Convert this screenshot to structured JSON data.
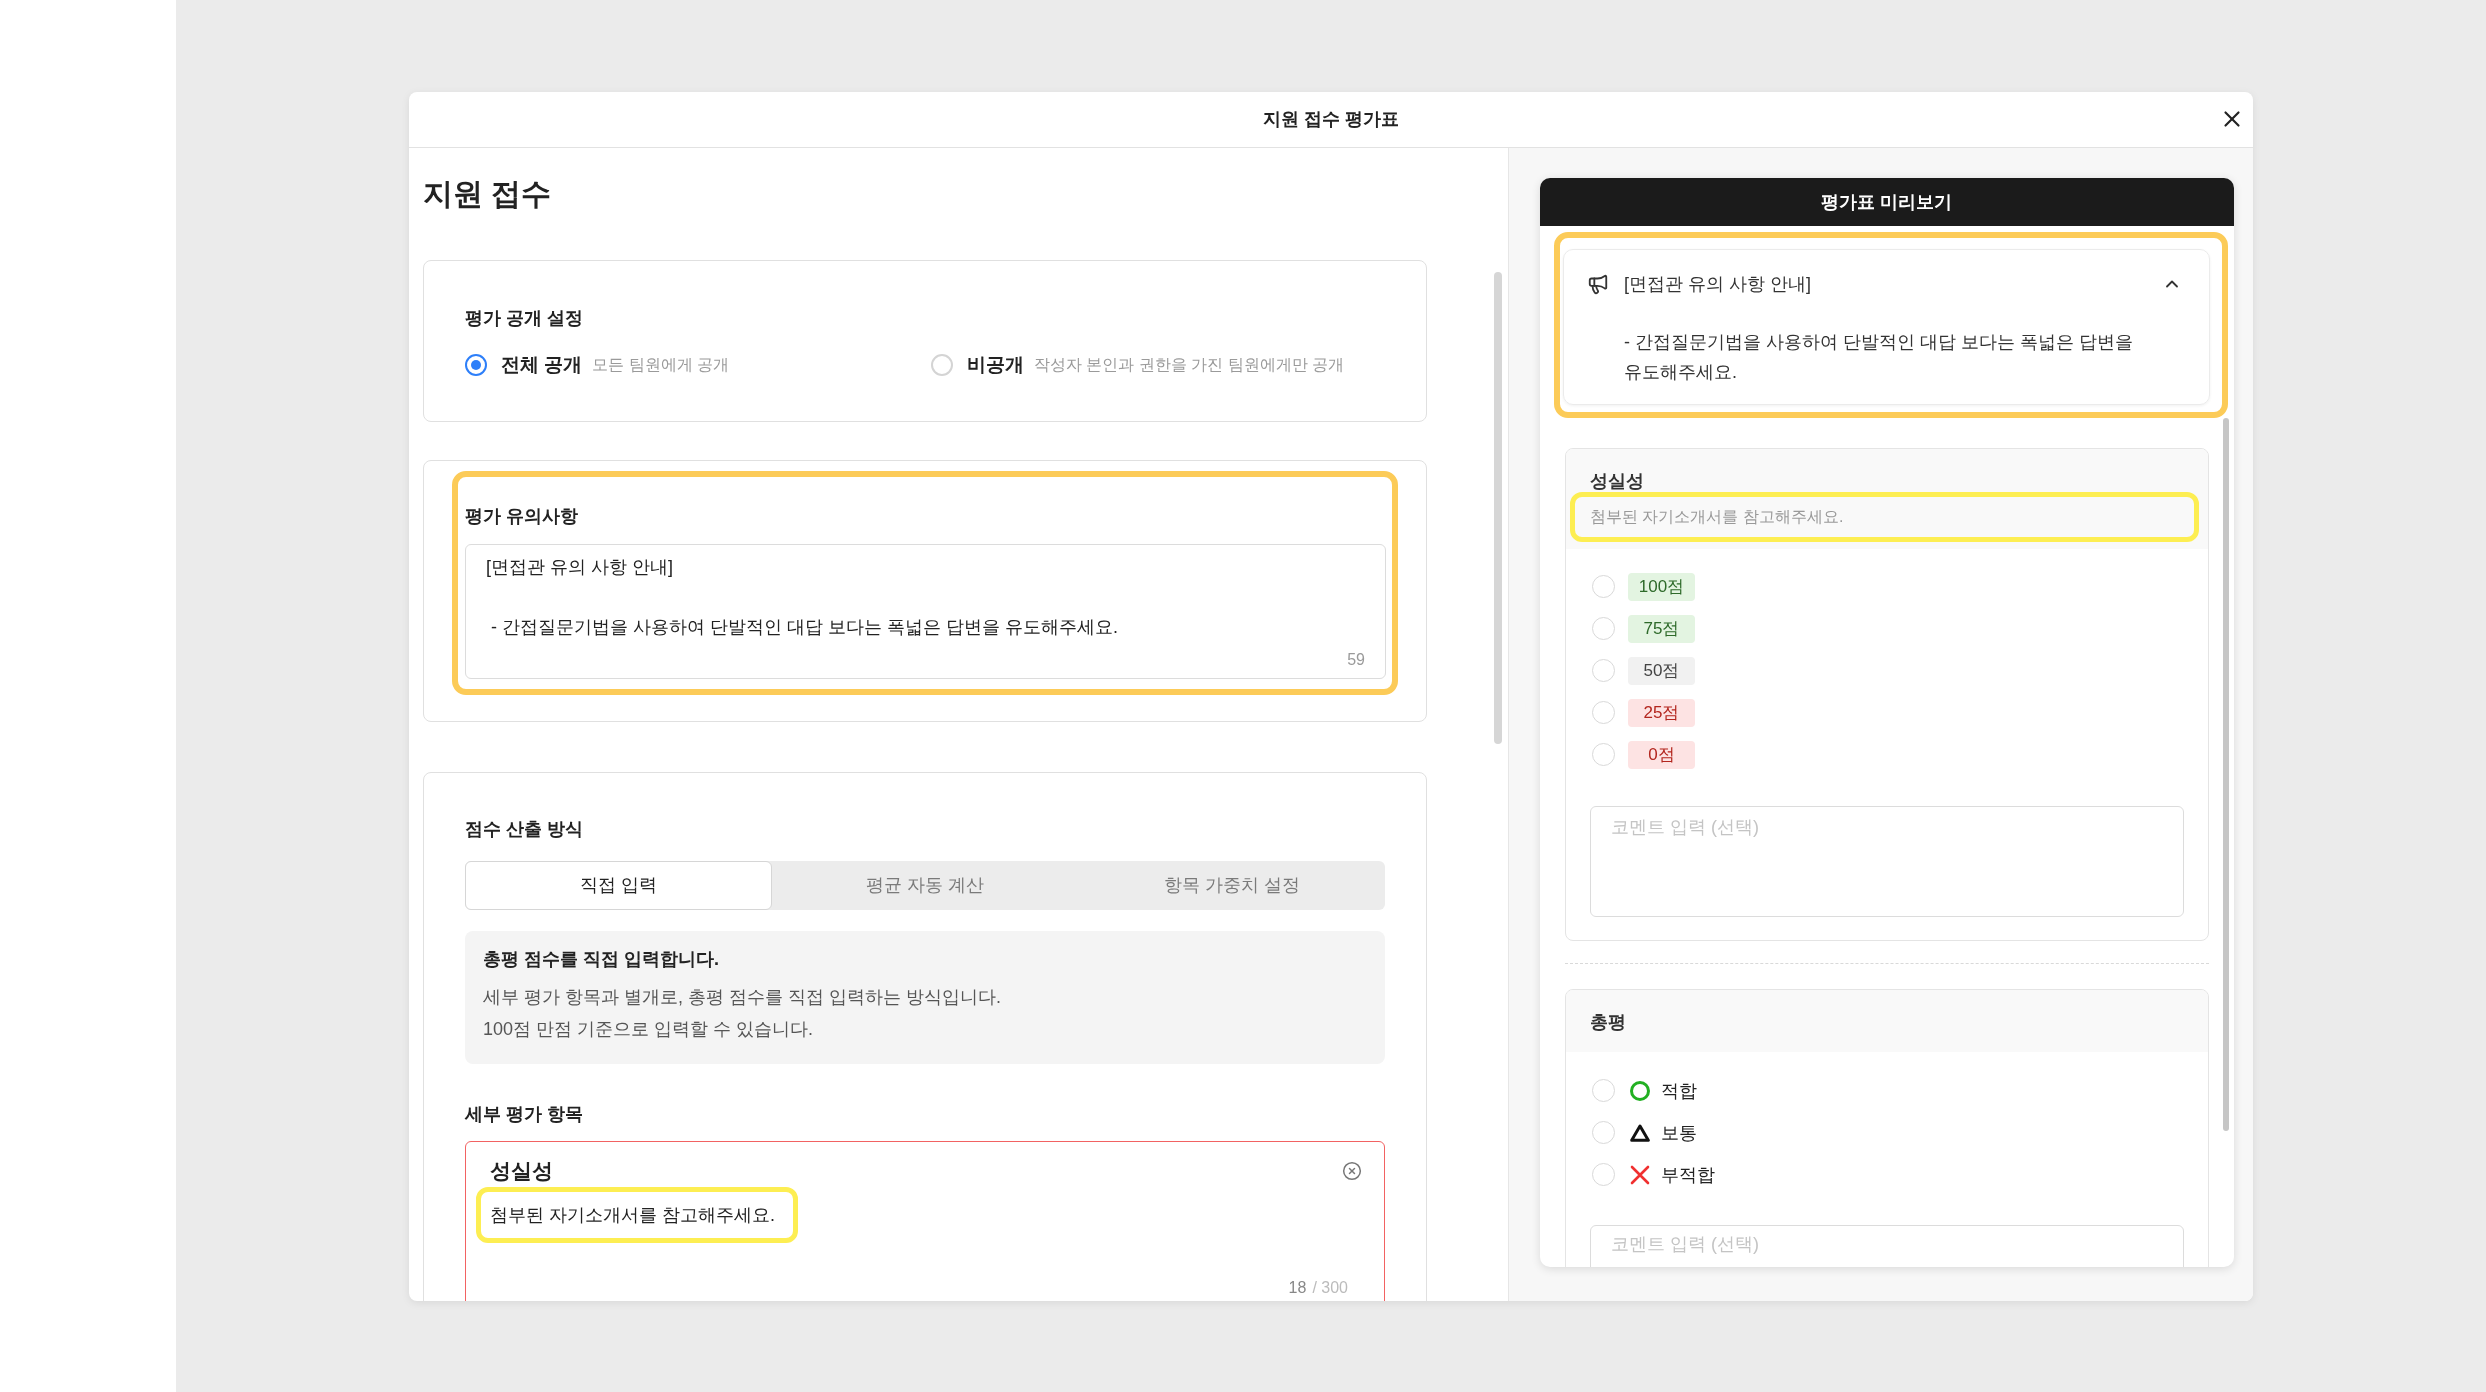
{
  "dialog": {
    "title": "지원 접수 평가표"
  },
  "form": {
    "title": "지원 접수",
    "visibility": {
      "label": "평가 공개 설정",
      "options": [
        {
          "label": "전체 공개",
          "description": "모든 팀원에게 공개",
          "selected": true
        },
        {
          "label": "비공개",
          "description": "작성자 본인과 권한을 가진 팀원에게만 공개",
          "selected": false
        }
      ]
    },
    "notes": {
      "label": "평가 유의사항",
      "highlighted": true,
      "value": "[면접관 유의 사항 안내]\n\n - 간접질문기법을 사용하여 단발적인 대답 보다는 폭넓은 답변을 유도해주세요.",
      "count": "59"
    },
    "scoring": {
      "label": "점수 산출 방식",
      "tabs": [
        {
          "label": "직접 입력",
          "selected": true
        },
        {
          "label": "평균 자동 계산",
          "selected": false
        },
        {
          "label": "항목 가중치 설정",
          "selected": false
        }
      ],
      "info": {
        "title": "총평 점수를 직접 입력합니다.",
        "lines": [
          "세부 평가 항목과 별개로, 총평 점수를 직접 입력하는 방식입니다.",
          "100점 만점 기준으로 입력할 수 있습니다."
        ]
      }
    },
    "details": {
      "label": "세부 평가 항목",
      "items": [
        {
          "title": "성실성",
          "description": "첨부된 자기소개서를 참고해주세요.",
          "highlighted": true,
          "invalid": true,
          "count": "18",
          "limit": "/ 300"
        }
      ]
    }
  },
  "preview": {
    "title": "평가표 미리보기",
    "notice": {
      "title": "[면접관 유의 사항 안내]",
      "body": "- 간접질문기법을 사용하여 단발적인 대답 보다는 폭넓은 답변을 유도해주세요.",
      "expanded": true,
      "highlighted": true
    },
    "criteria": [
      {
        "title": "성실성",
        "description": "첨부된 자기소개서를 참고해주세요.",
        "highlighted": true,
        "options": [
          {
            "label": "100점",
            "kind": "good",
            "selected": false
          },
          {
            "label": "75점",
            "kind": "good",
            "selected": false
          },
          {
            "label": "50점",
            "kind": "neutral",
            "selected": false
          },
          {
            "label": "25점",
            "kind": "bad",
            "selected": false
          },
          {
            "label": "0점",
            "kind": "bad",
            "selected": false
          }
        ],
        "comment": {
          "placeholder": "코멘트 입력 (선택)"
        }
      }
    ],
    "overall": {
      "title": "총평",
      "options": [
        {
          "label": "적합",
          "kind": "circle",
          "selected": false
        },
        {
          "label": "보통",
          "kind": "triangle",
          "selected": false
        },
        {
          "label": "부적합",
          "kind": "cross",
          "selected": false
        }
      ],
      "comment": {
        "placeholder": "코멘트 입력 (선택)"
      }
    }
  }
}
